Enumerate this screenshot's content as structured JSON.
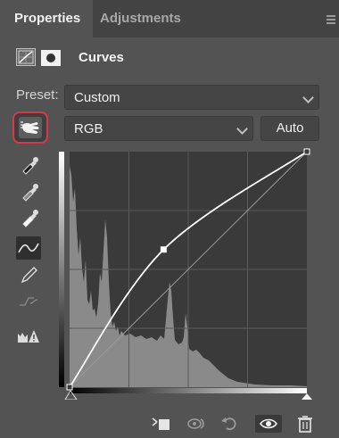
{
  "tabs": [
    {
      "label": "Properties"
    },
    {
      "label": "Adjustments"
    }
  ],
  "header": {
    "title": "Curves",
    "icons": [
      "curves-adjustment-icon",
      "layer-mask-icon"
    ]
  },
  "preset": {
    "label": "Preset:",
    "value": "Custom"
  },
  "channel": {
    "value": "RGB",
    "auto_label": "Auto"
  },
  "tools": [
    "on-image-adjust-icon",
    "black-point-eyedropper-icon",
    "gray-point-eyedropper-icon",
    "white-point-eyedropper-icon",
    "edit-points-icon",
    "pencil-icon",
    "smooth-icon",
    "clipping-warning-icon"
  ],
  "curve": {
    "input_range": [
      0,
      255
    ],
    "output_range": [
      0,
      255
    ],
    "points": [
      [
        0,
        0
      ],
      [
        101,
        149
      ],
      [
        255,
        255
      ]
    ],
    "histogram_visible": true
  },
  "bottom_bar": {
    "icons": [
      "clip-to-layer-icon",
      "view-previous-icon",
      "reset-icon",
      "visibility-icon",
      "delete-icon"
    ]
  },
  "colors": {
    "panel": "#535353",
    "tabbar": "#434343",
    "highlight_ring": "#d63a4a",
    "graph_bg": "#3a3a3a"
  }
}
